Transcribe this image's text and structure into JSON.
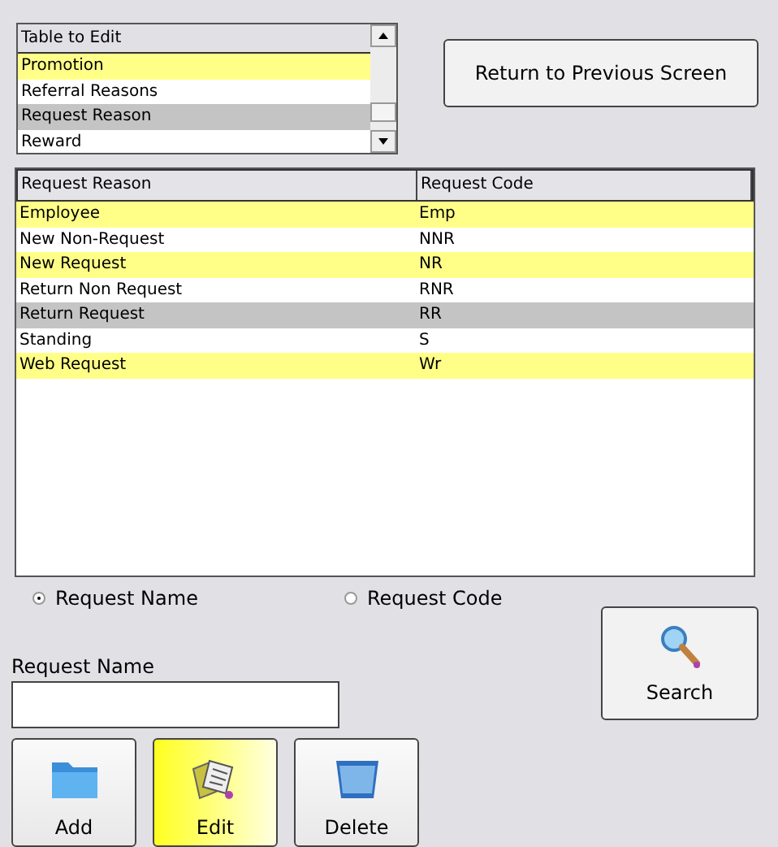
{
  "table_picker": {
    "header": "Table to Edit",
    "items": [
      {
        "label": "Promotion",
        "selected": false
      },
      {
        "label": "Referral Reasons",
        "selected": false
      },
      {
        "label": "Request Reason",
        "selected": true
      },
      {
        "label": "Reward",
        "selected": false
      }
    ]
  },
  "return_button": "Return to Previous Screen",
  "table": {
    "columns": [
      "Request Reason",
      "Request Code"
    ],
    "rows": [
      {
        "cells": [
          "Employee",
          "Emp"
        ],
        "selected": false
      },
      {
        "cells": [
          "New Non-Request",
          "NNR"
        ],
        "selected": false
      },
      {
        "cells": [
          "New Request",
          "NR"
        ],
        "selected": false
      },
      {
        "cells": [
          "Return Non Request",
          "RNR"
        ],
        "selected": false
      },
      {
        "cells": [
          "Return Request",
          "RR"
        ],
        "selected": true
      },
      {
        "cells": [
          "Standing",
          "S"
        ],
        "selected": false
      },
      {
        "cells": [
          "Web Request",
          "Wr"
        ],
        "selected": false
      }
    ]
  },
  "search_by": [
    {
      "label": "Request Name",
      "selected": true
    },
    {
      "label": "Request Code",
      "selected": false
    }
  ],
  "search_field": {
    "label": "Request Name"
  },
  "search_button": "Search",
  "buttons": [
    {
      "label": "Add",
      "kind": "add",
      "selected": false
    },
    {
      "label": "Edit",
      "kind": "edit",
      "selected": true
    },
    {
      "label": "Delete",
      "kind": "delete",
      "selected": false
    }
  ]
}
